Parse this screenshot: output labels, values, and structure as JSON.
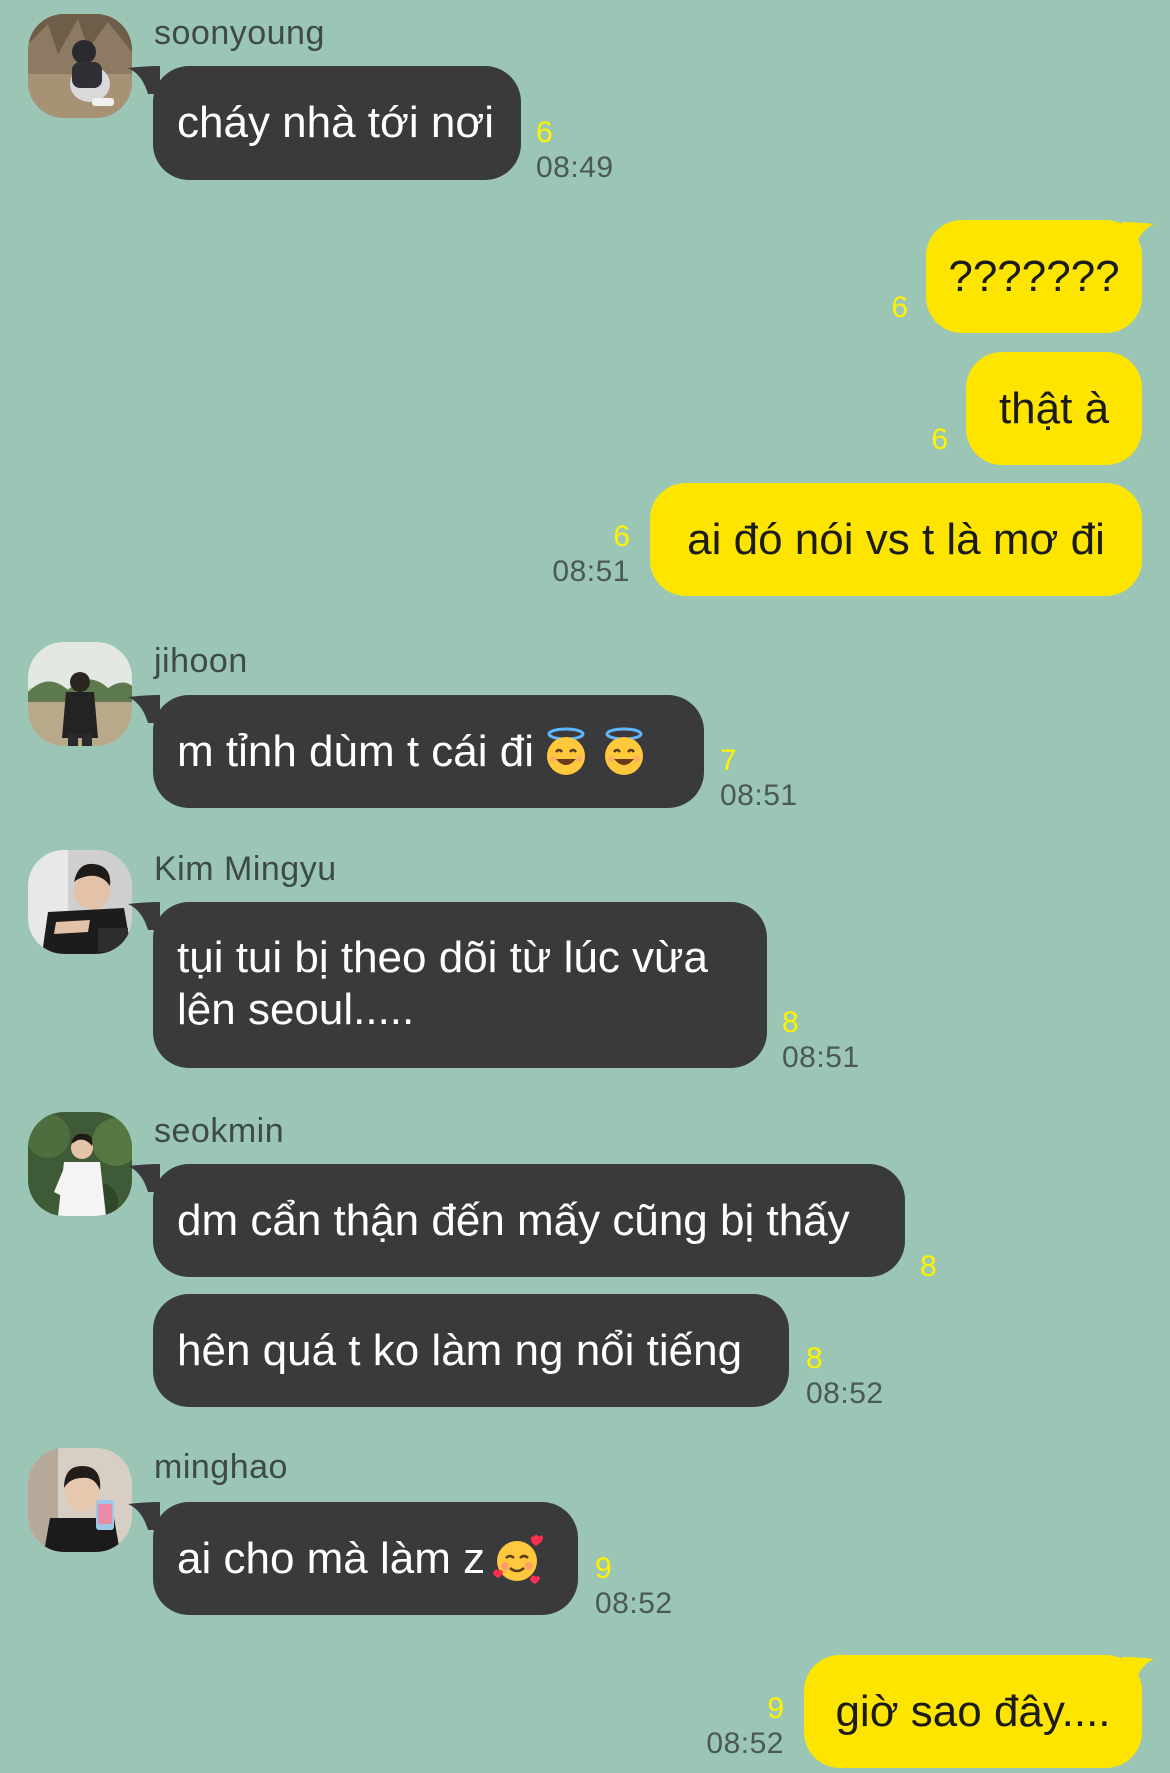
{
  "colors": {
    "background": "#9bc6b5",
    "incoming_bubble": "#3a3a3c",
    "outgoing_bubble": "#fee500",
    "unread_count": "#fef200",
    "timestamp": "#4a5954"
  },
  "messages": [
    {
      "sender": "soonyoung",
      "text": "cháy nhà tới nơi",
      "unread": "6",
      "time": "08:49"
    },
    {
      "text": "???????",
      "unread": "6"
    },
    {
      "text": "thật à",
      "unread": "6"
    },
    {
      "text": "ai đó nói vs t là mơ đi",
      "unread": "6",
      "time": "08:51"
    },
    {
      "sender": "jihoon",
      "text": "m tỉnh dùm t cái đi",
      "emoji": [
        "smiling-face-with-halo-icon",
        "smiling-face-with-halo-icon"
      ],
      "unread": "7",
      "time": "08:51"
    },
    {
      "sender": "Kim Mingyu",
      "text": "tụi tui bị theo dõi từ lúc vừa lên seoul.....",
      "unread": "8",
      "time": "08:51"
    },
    {
      "sender": "seokmin",
      "text": "dm cẩn thận đến mấy cũng bị thấy",
      "unread": "8"
    },
    {
      "text": "hên quá t ko làm ng nổi tiếng",
      "unread": "8",
      "time": "08:52"
    },
    {
      "sender": "minghao",
      "text": "ai cho mà làm z",
      "emoji": [
        "smiling-face-with-hearts-icon"
      ],
      "unread": "9",
      "time": "08:52"
    },
    {
      "text": "giờ sao đây....",
      "unread": "9",
      "time": "08:52"
    }
  ]
}
